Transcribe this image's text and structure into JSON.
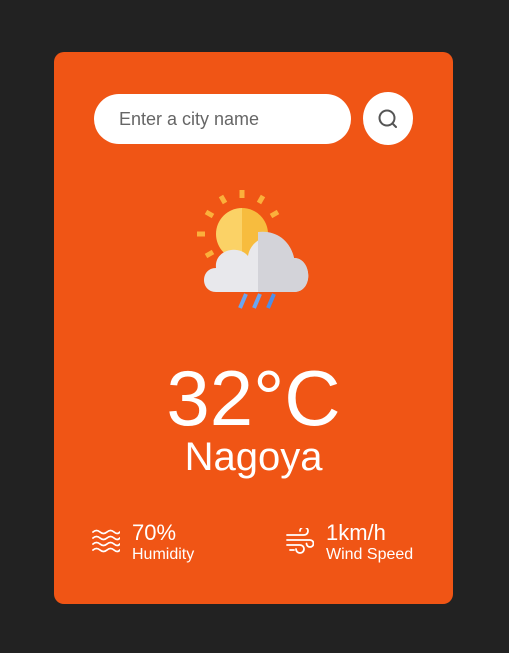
{
  "search": {
    "placeholder": "Enter a city name",
    "button_icon": "search-icon"
  },
  "weather": {
    "icon": "sun-cloud-rain-icon",
    "temperature": "32°C",
    "city": "Nagoya"
  },
  "details": {
    "humidity": {
      "icon": "waves-icon",
      "value": "70%",
      "label": "Humidity"
    },
    "wind": {
      "icon": "wind-icon",
      "value": "1km/h",
      "label": "Wind Speed"
    }
  },
  "colors": {
    "background": "#222222",
    "card": "#f05515",
    "text": "#ffffff"
  }
}
